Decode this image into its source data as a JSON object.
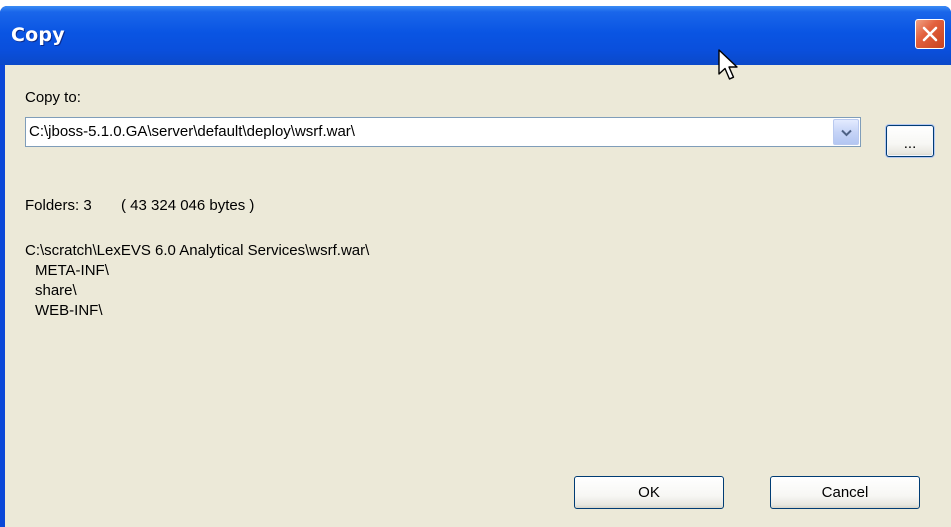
{
  "window": {
    "title": "Copy"
  },
  "icons": {
    "close": "close-icon",
    "dropdown": "chevron-down-icon",
    "cursor": "mouse-pointer-icon"
  },
  "colors": {
    "titlebar": "#0a55e3",
    "close_button": "#e2603d",
    "dialog_background": "#ece9d8",
    "button_border": "#003c74"
  },
  "copy_to": {
    "label": "Copy to:",
    "value": "C:\\jboss-5.1.0.GA\\server\\default\\deploy\\wsrf.war\\",
    "browse_label": "..."
  },
  "summary": {
    "folders_label": "Folders: 3",
    "bytes_label": "( 43 324 046 bytes )"
  },
  "source": {
    "path": "C:\\scratch\\LexEVS 6.0 Analytical Services\\wsrf.war\\",
    "folders": [
      "META-INF\\",
      "share\\",
      "WEB-INF\\"
    ]
  },
  "buttons": {
    "ok": "OK",
    "cancel": "Cancel"
  }
}
